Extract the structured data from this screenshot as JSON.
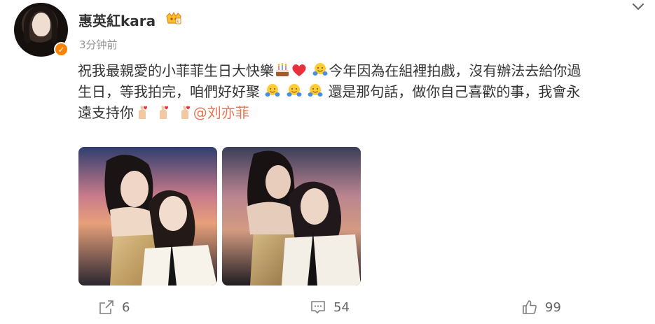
{
  "post": {
    "username": "惠英紅kara",
    "timestamp": "3分钟前",
    "line1_a": "祝我最親愛的小菲菲生日大快樂",
    "line1_b": "今年因為在組裡拍戲，沒有辦法去給你過",
    "line2_a": "生日，等我拍完，咱們好好聚",
    "line2_b": "還是那句話，做你自己喜歡的事，我會永",
    "line3_a": "遠支持你",
    "mention": "@刘亦菲"
  },
  "actions": {
    "share_count": "6",
    "comment_count": "54",
    "like_count": "99"
  },
  "colors": {
    "mention": "#eb7350",
    "verified": "#ff8200",
    "timestamp": "#939393",
    "action": "#636363"
  },
  "icons": [
    "cake-emoji",
    "heart-emoji",
    "hug-emoji",
    "finger-heart-emoji",
    "share-icon",
    "comment-icon",
    "like-icon",
    "chevron-down-icon",
    "verified-icon",
    "vip-icon"
  ]
}
